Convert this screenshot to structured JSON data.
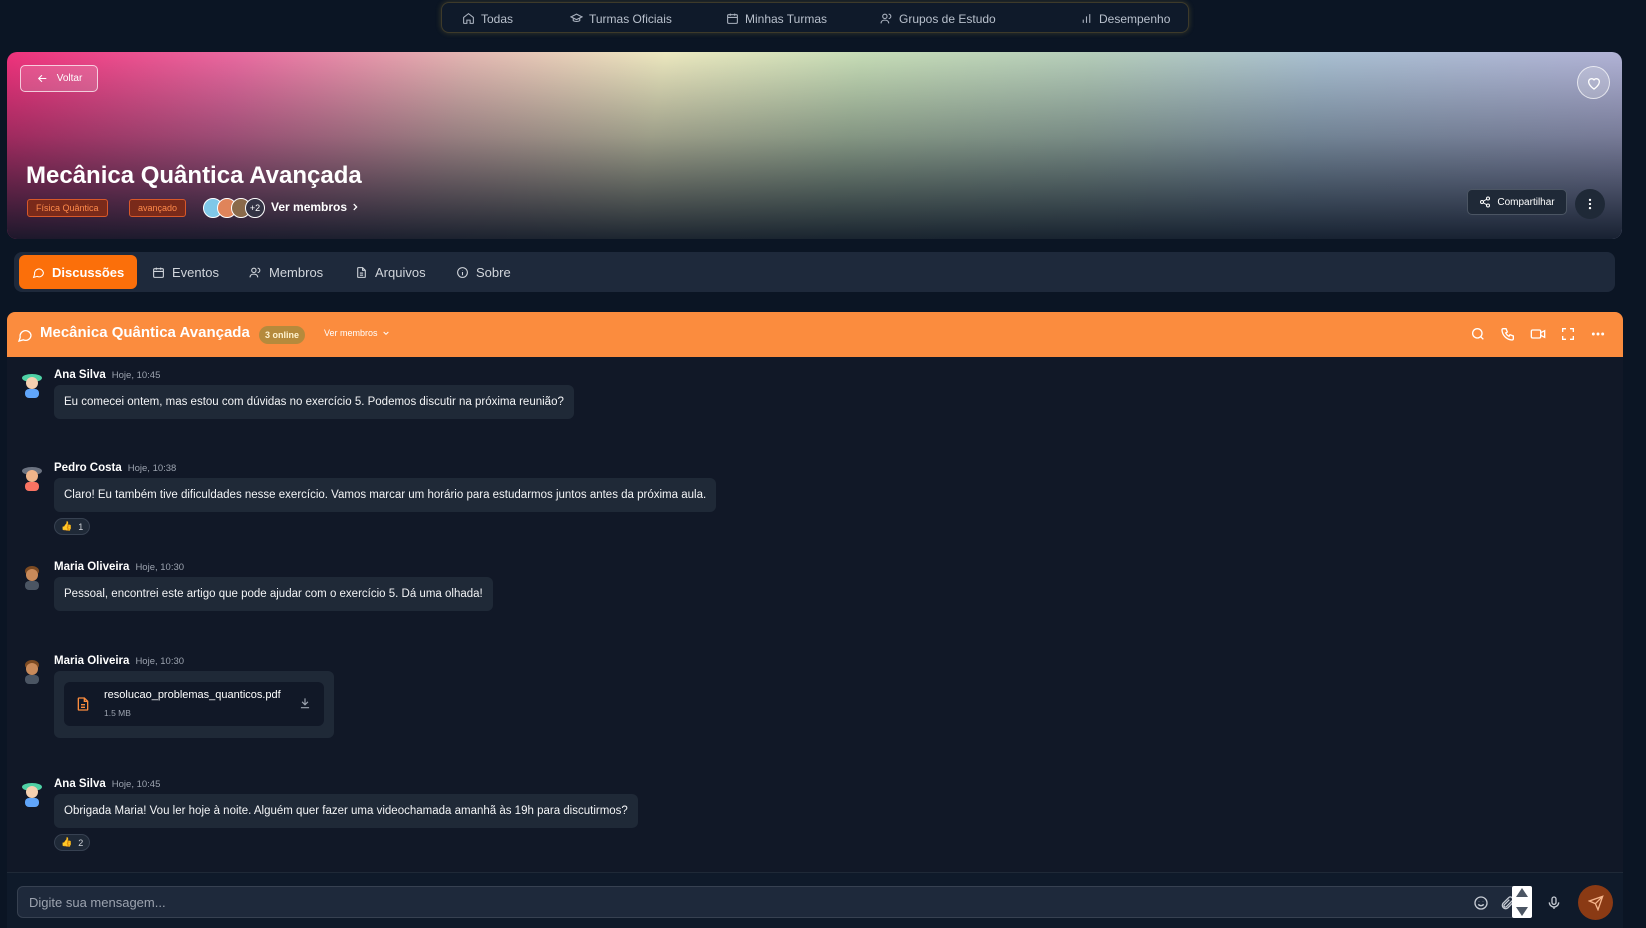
{
  "nav": {
    "items": [
      {
        "label": "Todas",
        "icon": "home-icon"
      },
      {
        "label": "Turmas Oficiais",
        "icon": "graduation-cap-icon"
      },
      {
        "label": "Minhas Turmas",
        "icon": "calendar-grid-icon"
      },
      {
        "label": "Grupos de Estudo",
        "icon": "users-icon"
      },
      {
        "label": "Desempenho",
        "icon": "bar-chart-icon"
      }
    ]
  },
  "hero": {
    "back_label": "Voltar",
    "title": "Mecânica Quântica Avançada",
    "tags": [
      "Física Quântica",
      "avançado"
    ],
    "extra_members": "+2",
    "members_link": "Ver membros",
    "share_label": "Compartilhar"
  },
  "tabs": [
    {
      "label": "Discussões",
      "icon": "chat-bubble-icon",
      "active": true
    },
    {
      "label": "Eventos",
      "icon": "calendar-icon",
      "active": false
    },
    {
      "label": "Membros",
      "icon": "users-icon",
      "active": false
    },
    {
      "label": "Arquivos",
      "icon": "file-icon",
      "active": false
    },
    {
      "label": "Sobre",
      "icon": "info-icon",
      "active": false
    }
  ],
  "chat": {
    "title": "Mecânica Quântica Avançada",
    "online": "3 online",
    "members_link": "Ver membros",
    "header_color": "#fb8c3e",
    "messages": [
      {
        "author": "Ana Silva",
        "time": "Hoje, 10:45",
        "text": "Eu comecei ontem, mas estou com dúvidas no exercício 5. Podemos discutir na próxima reunião?"
      },
      {
        "author": "Pedro Costa",
        "time": "Hoje, 10:38",
        "text": "Claro! Eu também tive dificuldades nesse exercício. Vamos marcar um horário para estudarmos juntos antes da próxima aula.",
        "reaction": {
          "emoji": "👍",
          "count": "1"
        }
      },
      {
        "author": "Maria Oliveira",
        "time": "Hoje, 10:30",
        "text": "Pessoal, encontrei este artigo que pode ajudar com o exercício 5. Dá uma olhada!"
      },
      {
        "author": "Maria Oliveira",
        "time": "Hoje, 10:30",
        "file": {
          "name": "resolucao_problemas_quanticos.pdf",
          "size": "1.5 MB"
        }
      },
      {
        "author": "Ana Silva",
        "time": "Hoje, 10:45",
        "text": "Obrigada Maria! Vou ler hoje à noite. Alguém quer fazer uma videochamada amanhã às 19h para discutirmos?",
        "reaction": {
          "emoji": "👍",
          "count": "2"
        }
      }
    ]
  },
  "composer": {
    "placeholder": "Digite sua mensagem..."
  },
  "colors": {
    "accent": "#fb6f0a",
    "background": "#0b1524",
    "tag_text": "#ff8a4a"
  }
}
